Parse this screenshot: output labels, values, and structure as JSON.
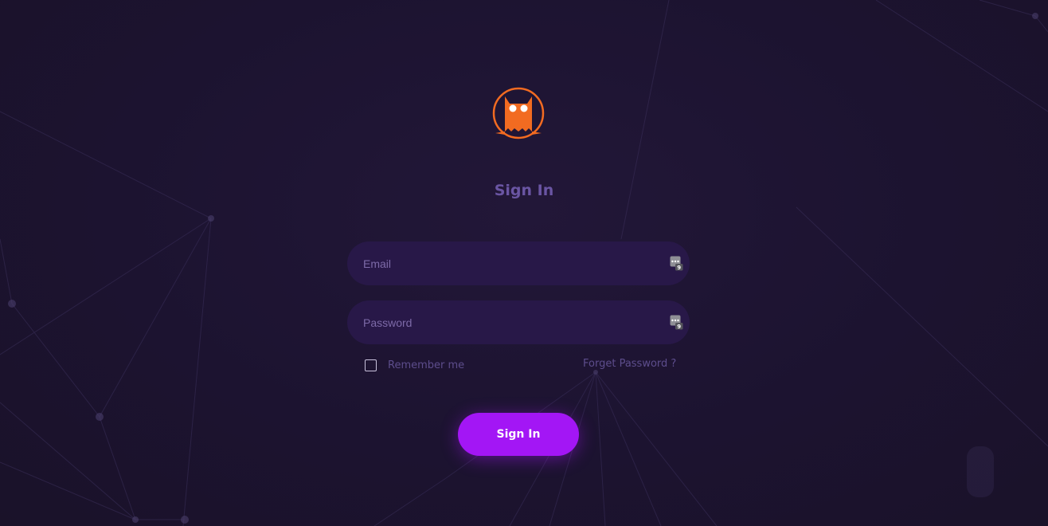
{
  "brand": {
    "logo_icon": "owl-logo-icon",
    "accent_color": "#f26b21"
  },
  "form": {
    "title": "Sign In",
    "email": {
      "placeholder": "Email",
      "value": "",
      "icon": "password-manager-icon"
    },
    "password": {
      "placeholder": "Password",
      "value": "",
      "icon": "password-manager-icon"
    },
    "remember_label": "Remember me",
    "remember_checked": false,
    "forgot_label": "Forget Password ?",
    "submit_label": "Sign In",
    "submit_color": "#a316f5"
  },
  "theme": {
    "background": "#1e1432",
    "field_background": "#281848",
    "muted_text": "#5d4d8c"
  }
}
